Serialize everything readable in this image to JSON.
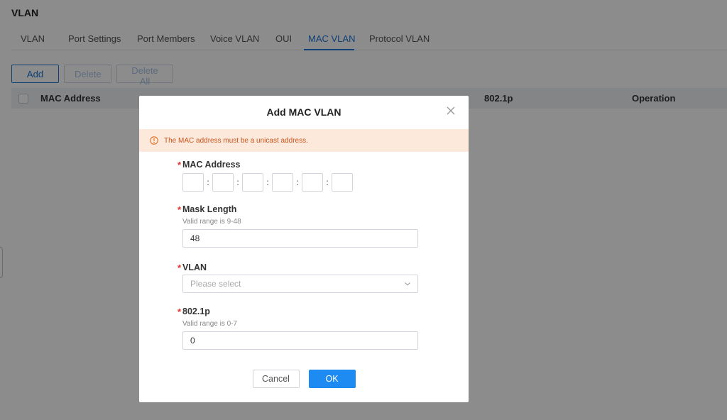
{
  "page": {
    "title": "VLAN"
  },
  "tabs": [
    {
      "label": "VLAN"
    },
    {
      "label": "Port Settings"
    },
    {
      "label": "Port Members"
    },
    {
      "label": "Voice VLAN"
    },
    {
      "label": "OUI"
    },
    {
      "label": "MAC VLAN",
      "active": true
    },
    {
      "label": "Protocol VLAN"
    }
  ],
  "toolbar": {
    "add": "Add",
    "delete": "Delete",
    "delete_all": "Delete All"
  },
  "table": {
    "columns": {
      "mac_address": "MAC Address",
      "col_8021p": "802.1p",
      "operation": "Operation"
    }
  },
  "dialog": {
    "title": "Add MAC VLAN",
    "alert": "The MAC address must be a unicast address.",
    "fields": {
      "mac": {
        "label": "MAC Address",
        "separator": ":"
      },
      "mask": {
        "label": "Mask Length",
        "hint": "Valid range is 9-48",
        "value": "48"
      },
      "vlan": {
        "label": "VLAN",
        "placeholder": "Please select"
      },
      "p8021": {
        "label": "802.1p",
        "hint": "Valid range is 0-7",
        "value": "0"
      }
    },
    "required_mark": "*",
    "cancel": "Cancel",
    "ok": "OK"
  },
  "colors": {
    "accent": "#1a75d8",
    "ok_button": "#1e8bf2",
    "alert_bg": "#fde9dc",
    "alert_text": "#c8541a",
    "required": "#e5322d"
  }
}
